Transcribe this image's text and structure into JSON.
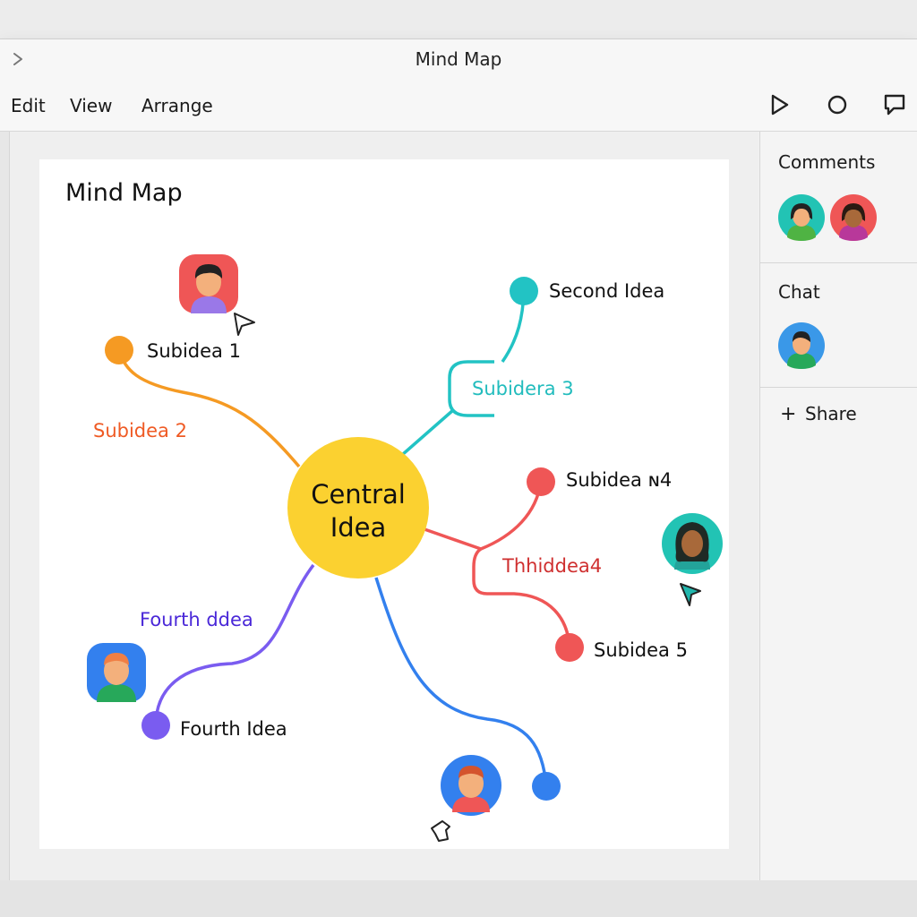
{
  "window": {
    "title": "Mind Map"
  },
  "menu": {
    "items": [
      "Edit",
      "View",
      "Arrange"
    ]
  },
  "toolbar": {
    "icons": [
      "play-icon",
      "circle-icon",
      "comment-icon"
    ]
  },
  "canvas": {
    "title": "Mind Map"
  },
  "mindmap": {
    "central": {
      "line1": "Central",
      "line2": "Idea",
      "color": "#fbd130"
    },
    "labels": {
      "subidea1": "Subidea 1",
      "subidea2": "Subidea 2",
      "second_idea": "Second Idea",
      "subidera3": "Subidera 3",
      "subidea4": "Subidea ɴ4",
      "thhiddea4": "Thhiddea4",
      "subidea5": "Subidea 5",
      "fourth_ddea": "Fourth ddea",
      "fourth_idea": "Fourth Idea"
    },
    "colors": {
      "orange": "#f59a23",
      "orange_label": "#ef5a24",
      "teal": "#22c3c4",
      "red": "#ef5656",
      "red_label": "#cf2f2f",
      "purple": "#7a5cf0",
      "purple_label": "#4a28d8",
      "blue": "#3380ee"
    }
  },
  "sidebar": {
    "comments_title": "Comments",
    "chat_title": "Chat",
    "share_label": "Share"
  }
}
